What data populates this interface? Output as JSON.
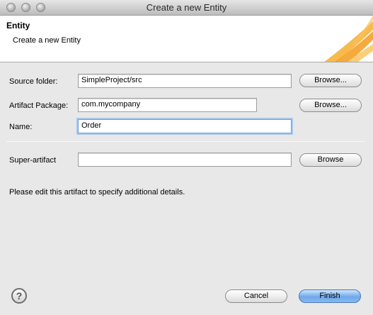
{
  "window": {
    "title": "Create a new Entity"
  },
  "banner": {
    "heading": "Entity",
    "description": "Create a new Entity"
  },
  "form": {
    "source_folder": {
      "label": "Source folder:",
      "value": "SimpleProject/src",
      "button": "Browse..."
    },
    "artifact_package": {
      "label": "Artifact Package:",
      "value": "com.mycompany",
      "button": "Browse..."
    },
    "name": {
      "label": "Name:",
      "value": "Order"
    },
    "super_artifact": {
      "label": "Super-artifact",
      "value": "",
      "button": "Browse"
    }
  },
  "info_message": "Please edit this artifact to specify additional details.",
  "footer": {
    "help_icon": "?",
    "cancel": "Cancel",
    "finish": "Finish"
  },
  "icons": {
    "help": "help-icon",
    "close": "close-icon",
    "minimize": "minimize-icon",
    "zoom": "zoom-icon"
  },
  "colors": {
    "accent": "#6fa7e8",
    "banner_art": "#f5a623"
  }
}
